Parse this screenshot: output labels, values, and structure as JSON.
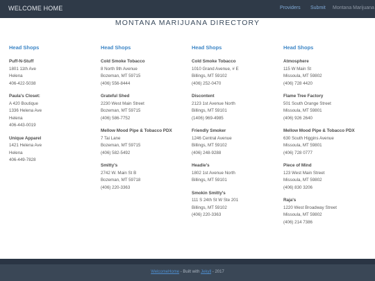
{
  "navbar": {
    "brand": "WELCOME HOME",
    "links": [
      "Providers",
      "Submit"
    ],
    "muted": "Montana Marijuana"
  },
  "title": "MONTANA MARIJUANA DIRECTORY",
  "columns": [
    {
      "heading": "Head Shops",
      "shops": [
        {
          "name": "Puff-N-Stuff",
          "lines": [
            "1801 11th Ave",
            "Helena",
            "406-422-5038"
          ]
        },
        {
          "name": "Paula's Closet:",
          "lines": [
            "A 420 Boutique",
            "1336 Helena Ave",
            "Helena",
            "406-443-0019"
          ]
        },
        {
          "name": "Unique Apparel",
          "lines": [
            "1421 Helena Ave",
            "Helena",
            "406-449-7828"
          ]
        }
      ]
    },
    {
      "heading": "Head Shops",
      "shops": [
        {
          "name": "Cold Smoke Tobacco",
          "lines": [
            "8 North 9th Avenue",
            "Bozeman, MT 59715",
            "(406) 556-8444"
          ]
        },
        {
          "name": "Grateful Shed",
          "lines": [
            "2230 West Main Street",
            "Bozeman, MT 59715",
            "(406) 586-7752"
          ]
        },
        {
          "name": "Mellow Mood Pipe & Tobacco PDX",
          "lines": [
            "7 Tai Lane",
            "Bozeman, MT 59715",
            "(406) 582-5492"
          ]
        },
        {
          "name": "Smitty's",
          "lines": [
            "2742 W. Main St B",
            "Bozeman, MT 59718",
            "(406) 220-3363"
          ]
        }
      ]
    },
    {
      "heading": "Head Shops",
      "shops": [
        {
          "name": "Cold Smoke Tobacco",
          "lines": [
            "1010 Grand Avenue, # E",
            "Billings, MT 59102",
            "(406) 252-0470"
          ]
        },
        {
          "name": "Discontent",
          "lines": [
            "2123 1st Avenue North",
            "Billings, MT 59101",
            "(1406) 969-4985"
          ]
        },
        {
          "name": "Friendly Smoker",
          "lines": [
            "1246 Central Avenue",
            "Billings, MT 59102",
            "(406) 248-9288"
          ]
        },
        {
          "name": "Headie's",
          "lines": [
            "1802 1st Avenue North",
            "Billings, MT 59101"
          ]
        },
        {
          "name": "Smokin Smitty's",
          "lines": [
            "111 S 24th St W Ste 201",
            "Billings, MT 59102",
            "(406) 220-3363"
          ]
        }
      ]
    },
    {
      "heading": "Head Shops",
      "shops": [
        {
          "name": "Atmosphere",
          "lines": [
            "115 W Main St",
            "Missoula, MT 59802",
            "(406) 728 4420"
          ]
        },
        {
          "name": "Flame Tree Factory",
          "lines": [
            "501 South Orange Street",
            "Missoula, MT 59801",
            "(406) 926 2640"
          ]
        },
        {
          "name": "Mellow Mood Pipe & Tobacco PDX",
          "lines": [
            "630 South Higgins Avenue",
            "Missoula, MT 59801",
            "(406) 728 0777"
          ]
        },
        {
          "name": "Piece of Mind",
          "lines": [
            "123 West Main Street",
            "Missoula, MT 59802",
            "(406) 830 3206"
          ]
        },
        {
          "name": "Raja's",
          "lines": [
            "1220 West Broadway Street",
            "Missoula, MT 59802",
            "(406) 214 7386"
          ]
        }
      ]
    }
  ],
  "footer": {
    "link1": "WelcomeHome",
    "text1": " - Built with ",
    "link2": "Jekyll",
    "text2": " - 2017"
  }
}
